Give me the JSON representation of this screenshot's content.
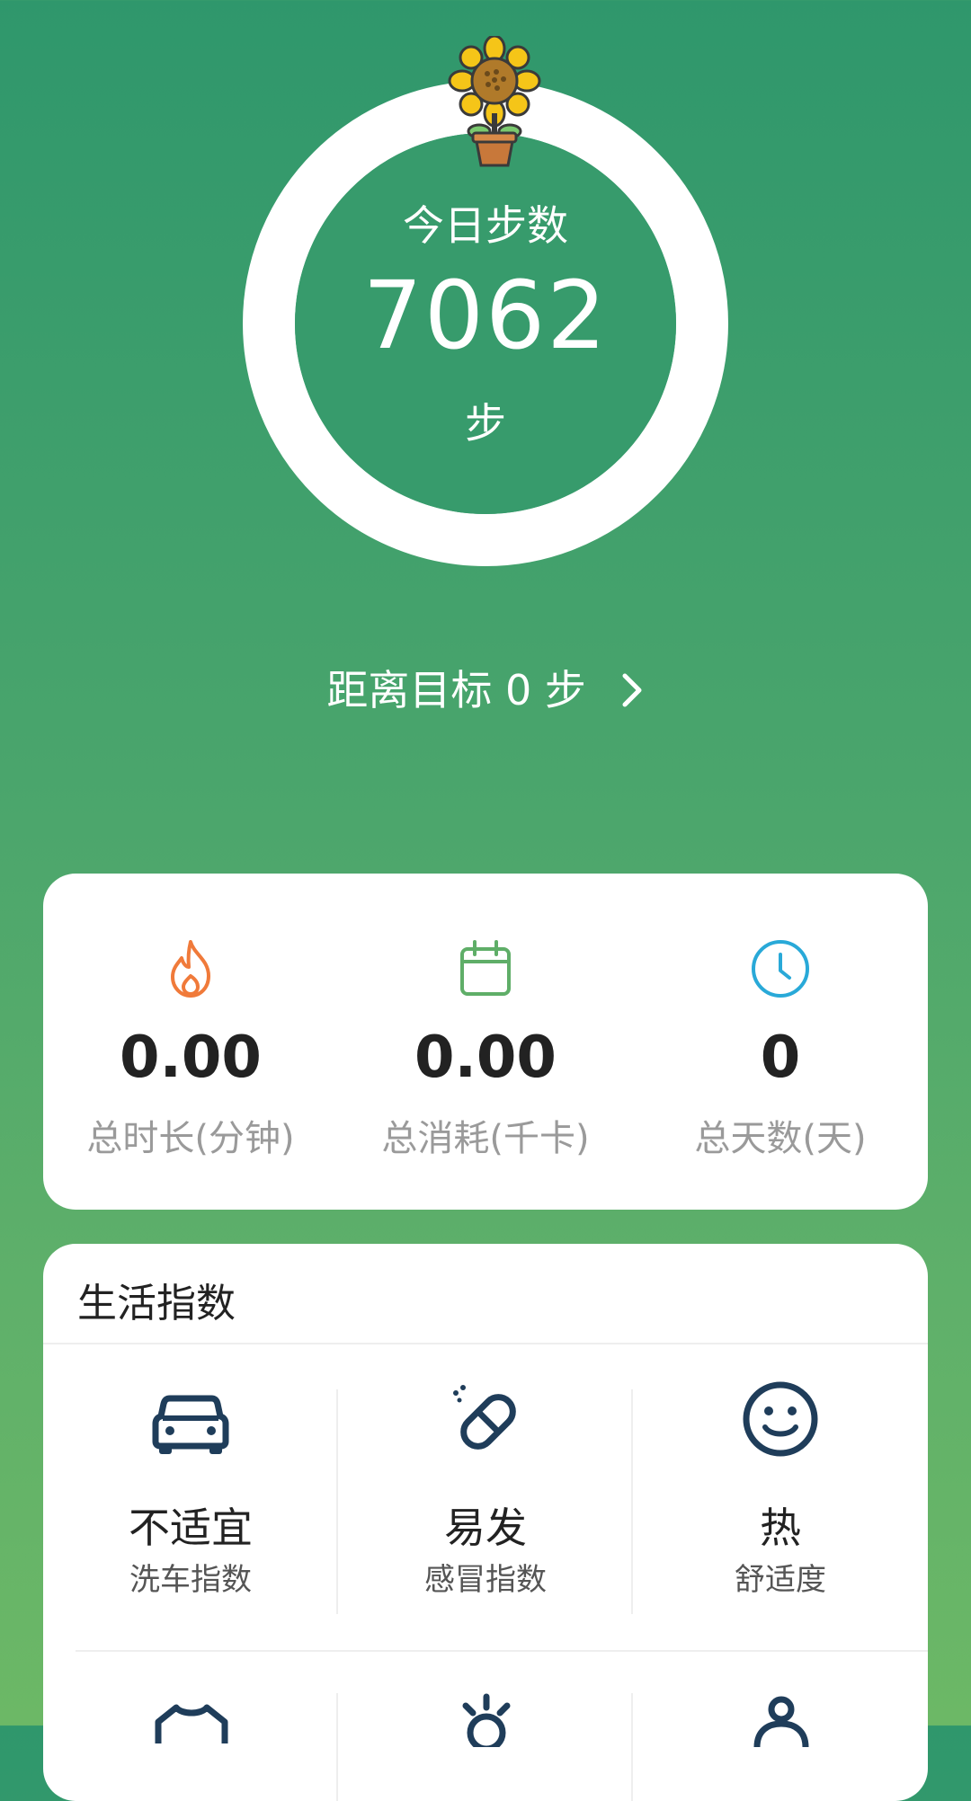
{
  "steps": {
    "title": "今日步数",
    "value": "7062",
    "unit": "步",
    "progress": 1.0
  },
  "goal": {
    "text": "距离目标 0 步",
    "chevron_icon": "chevron-right-icon"
  },
  "stats": [
    {
      "icon": "flame-icon",
      "value": "0.00",
      "label": "总时长(分钟)",
      "color": "#f07a3a"
    },
    {
      "icon": "calendar-icon",
      "value": "0.00",
      "label": "总消耗(千卡)",
      "color": "#5fae68"
    },
    {
      "icon": "clock-icon",
      "value": "0",
      "label": "总天数(天)",
      "color": "#29a9d8"
    }
  ],
  "life": {
    "title": "生活指数",
    "items": [
      {
        "icon": "car-icon",
        "value": "不适宜",
        "label": "洗车指数"
      },
      {
        "icon": "pill-icon",
        "value": "易发",
        "label": "感冒指数"
      },
      {
        "icon": "smile-icon",
        "value": "热",
        "label": "舒适度"
      }
    ],
    "icon_color": "#1f3d5a",
    "row2_icons": [
      "shirt-icon",
      "sun-icon",
      "person-icon"
    ]
  },
  "colors": {
    "background_top": "#2f976c",
    "background_bottom": "#6cb866"
  }
}
